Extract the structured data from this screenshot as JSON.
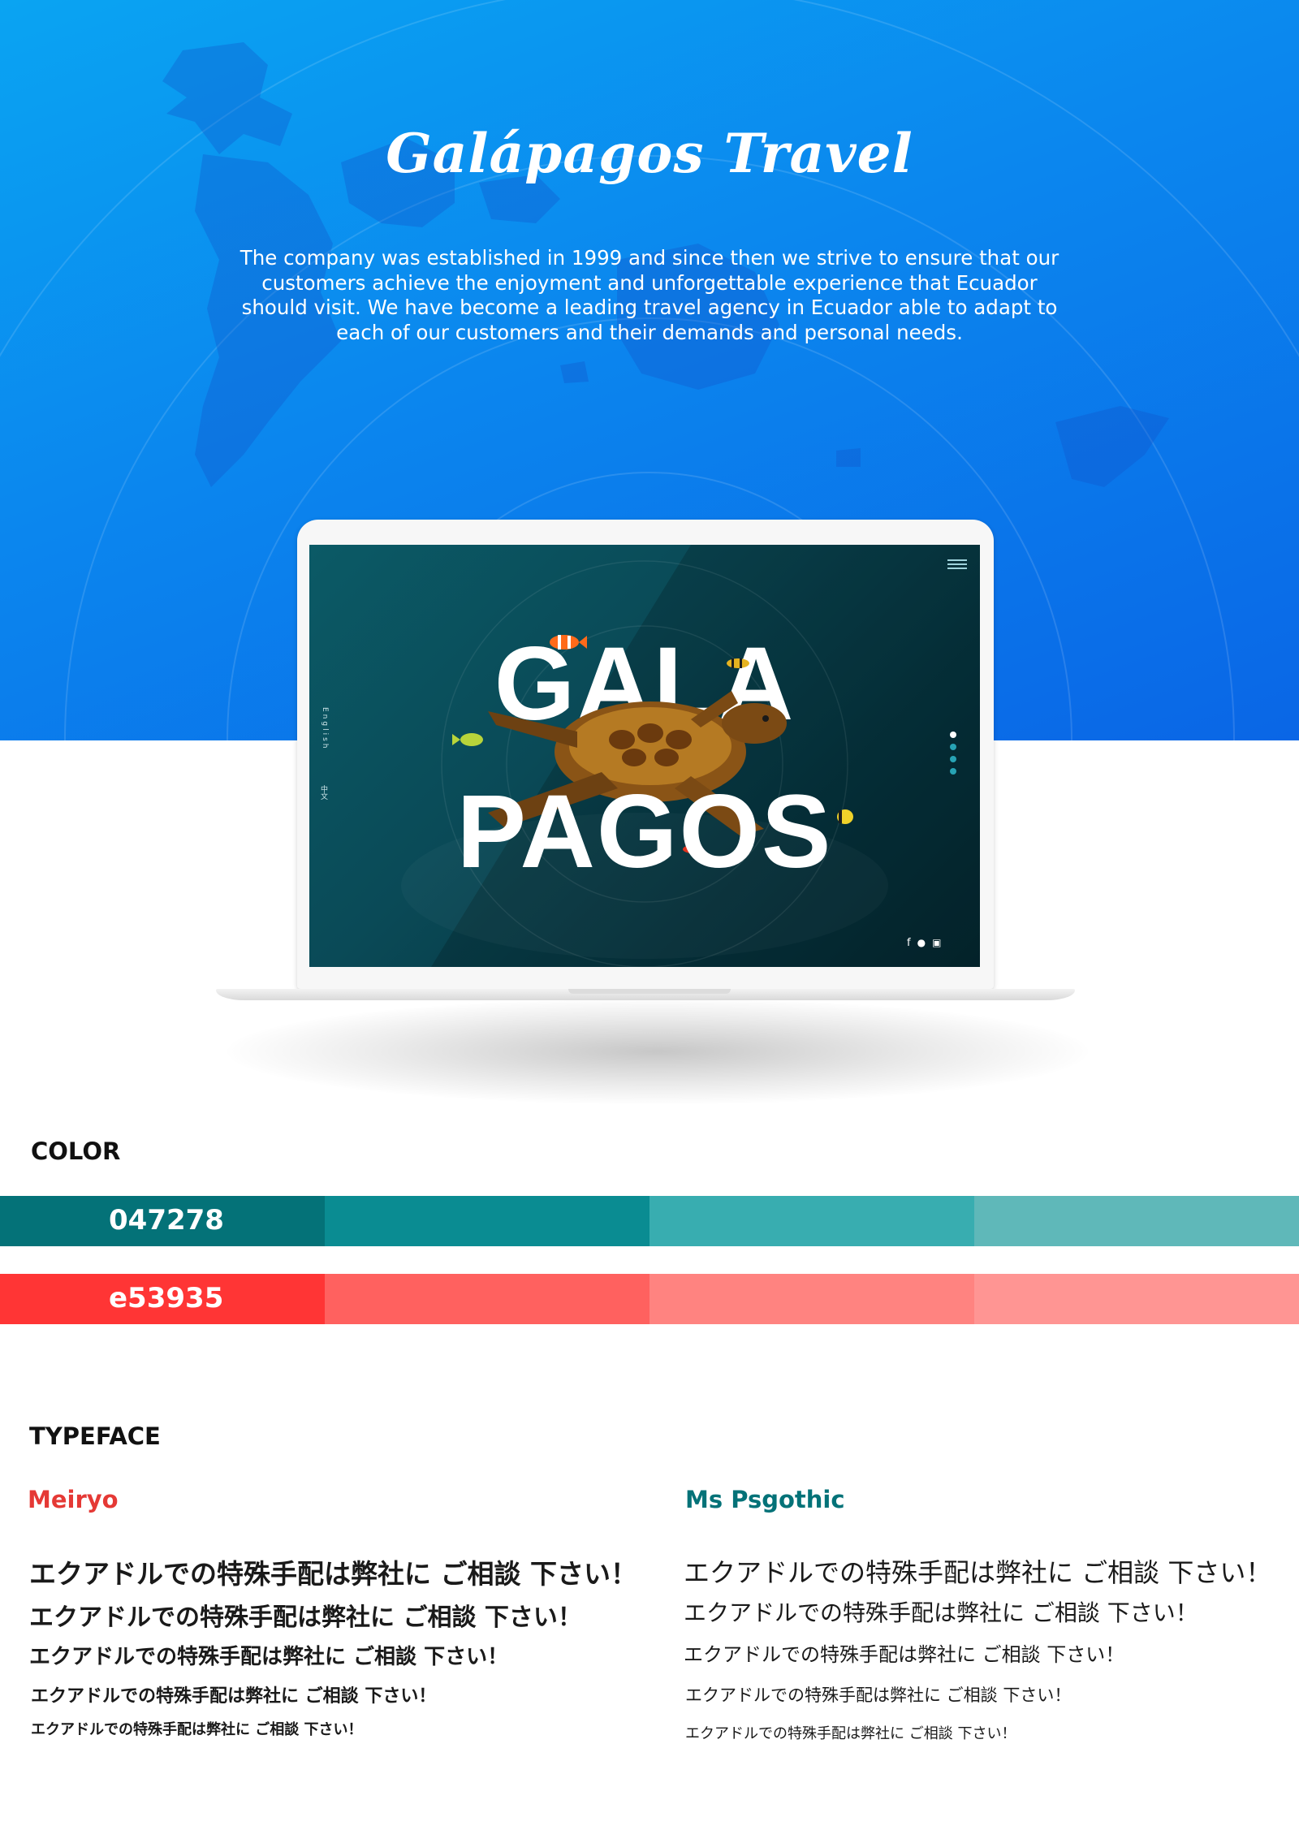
{
  "hero": {
    "title": "Galápagos Travel",
    "description": "The company was established in 1999 and since then we strive to ensure that our customers achieve the enjoyment and unforgettable experience that Ecuador should visit. We have become a leading travel agency in Ecuador able to adapt to each of our customers and their demands and personal needs."
  },
  "laptop_screen": {
    "headline_line1": "GALA",
    "headline_line2": "PAGOS",
    "menu_icon": "hamburger-menu-icon",
    "language_english": "English",
    "language_chinese": "中文",
    "slide_dots": [
      {
        "active": true
      },
      {
        "active": false
      },
      {
        "active": false
      },
      {
        "active": false
      }
    ],
    "social_icons": [
      {
        "icon": "facebook-icon",
        "glyph": "f"
      },
      {
        "icon": "twitter-icon",
        "glyph": "🐦"
      },
      {
        "icon": "instagram-icon",
        "glyph": "◘"
      }
    ]
  },
  "color_section": {
    "title": "COLOR",
    "palettes": [
      {
        "label": "047278",
        "shades": [
          "#047278",
          "#0a8c92",
          "#38adb0",
          "#5fb8b9"
        ]
      },
      {
        "label": "e53935",
        "shades": [
          "#ff3535",
          "#ff615f",
          "#ff8380",
          "#ff9593"
        ]
      }
    ]
  },
  "typeface_section": {
    "title": "TYPEFACE",
    "faces": [
      {
        "name": "Meiryo",
        "name_color": "#e53935",
        "samples": [
          "エクアドルでの特殊手配は弊社に ご相談 下さい！",
          "エクアドルでの特殊手配は弊社に ご相談 下さい！",
          "エクアドルでの特殊手配は弊社に ご相談 下さい！",
          "エクアドルでの特殊手配は弊社に ご相談 下さい！",
          "エクアドルでの特殊手配は弊社に ご相談 下さい！"
        ]
      },
      {
        "name": "Ms Psgothic",
        "name_color": "#047278",
        "samples": [
          "エクアドルでの特殊手配は弊社に ご相談 下さい！",
          "エクアドルでの特殊手配は弊社に ご相談 下さい！",
          "エクアドルでの特殊手配は弊社に ご相談 下さい！",
          "エクアドルでの特殊手配は弊社に ご相談 下さい！",
          "エクアドルでの特殊手配は弊社に ご相談 下さい！"
        ]
      }
    ]
  }
}
